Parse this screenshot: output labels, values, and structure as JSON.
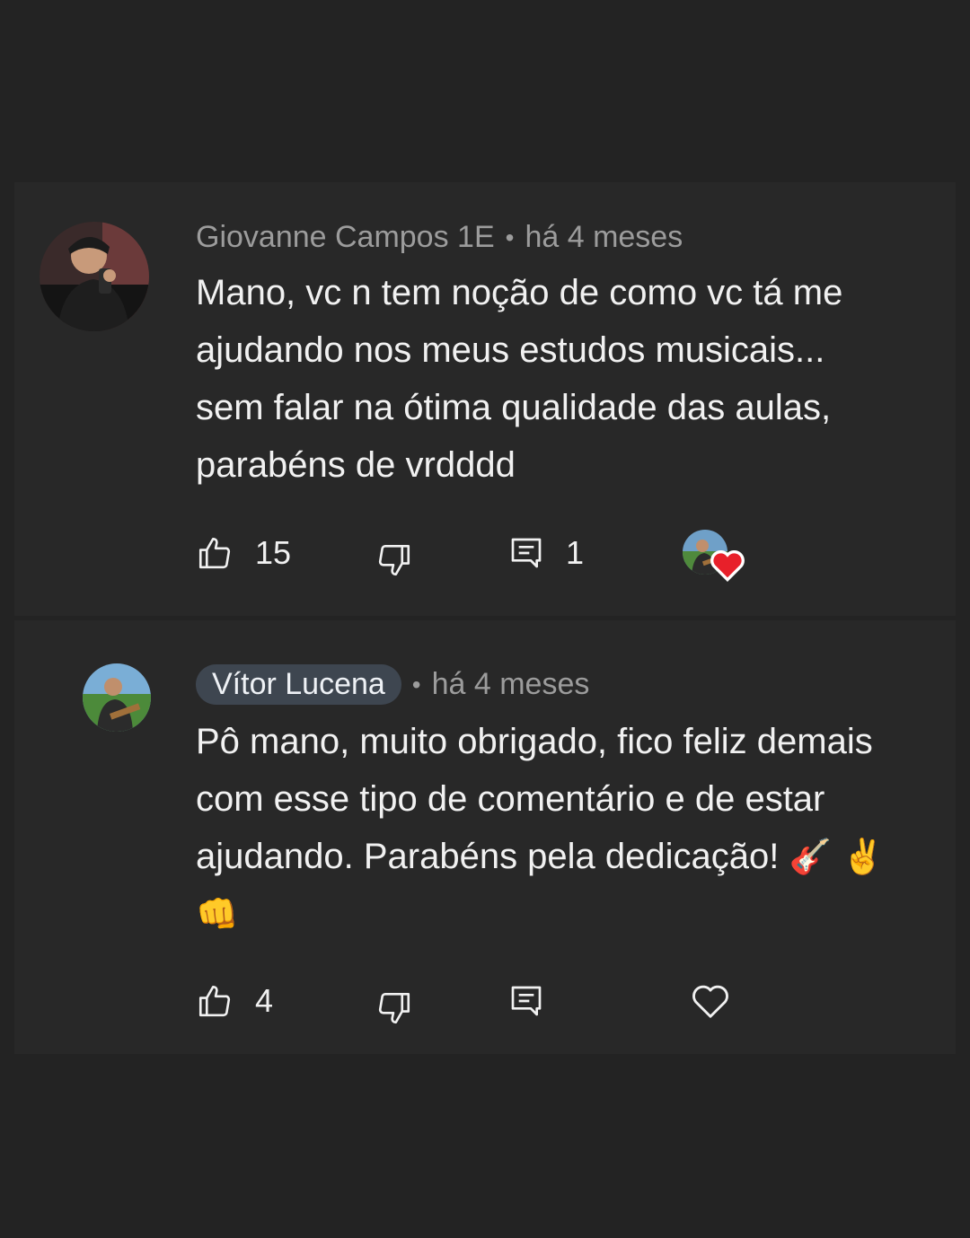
{
  "comments": [
    {
      "author": "Giovanne Campos 1E",
      "separator": "•",
      "time": "há 4 meses",
      "lines": [
        "Mano, vc n tem noção de como vc tá me",
        "ajudando nos meus estudos musicais...",
        "sem falar na ótima qualidade das aulas,",
        "parabéns de vrdddd"
      ],
      "likes": "15",
      "replies": "1",
      "creator_hearted": true
    },
    {
      "author": "Vítor Lucena",
      "separator": "•",
      "time": "há 4 meses",
      "lines": [
        "Pô mano, muito obrigado, fico feliz demais",
        "com esse tipo de comentário e de estar",
        "ajudando. Parabéns pela dedicação!"
      ],
      "emojis": [
        "🎸",
        "✌️",
        "👊"
      ],
      "likes": "4",
      "creator_hearted": false
    }
  ],
  "icons": {
    "like": "thumb-up-icon",
    "dislike": "thumb-down-icon",
    "reply": "reply-comment-icon",
    "heart": "heart-icon"
  },
  "colors": {
    "background": "#232323",
    "card": "#282828",
    "heart_red": "#e8202a",
    "author_pill": "#3e4650",
    "meta_text": "#9c9c9c"
  }
}
